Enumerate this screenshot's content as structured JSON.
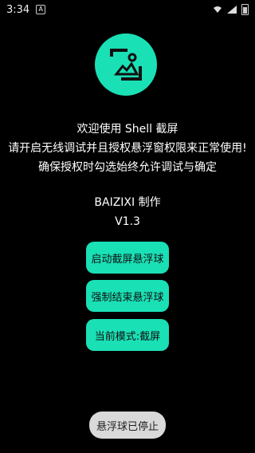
{
  "status_bar": {
    "time": "3:34",
    "notification_icon": "notification-icon",
    "wifi_icon": "wifi-icon",
    "signal_icon": "signal-icon",
    "battery_icon": "battery-icon"
  },
  "app": {
    "logo_icon": "screenshot-icon",
    "welcome_lines": [
      "欢迎使用 Shell 截屏",
      "请开启无线调试并且授权悬浮窗权限来正常使用!",
      "确保授权时勾选始终允许调试与确定"
    ],
    "credit_lines": [
      "BAIZIXI 制作",
      "V1.3"
    ],
    "buttons": {
      "start_float": "启动截屏悬浮球",
      "stop_float": "强制结束悬浮球",
      "current_mode": "当前模式:截屏"
    },
    "toast": "悬浮球已停止",
    "accent_color": "#1ae0b6"
  }
}
